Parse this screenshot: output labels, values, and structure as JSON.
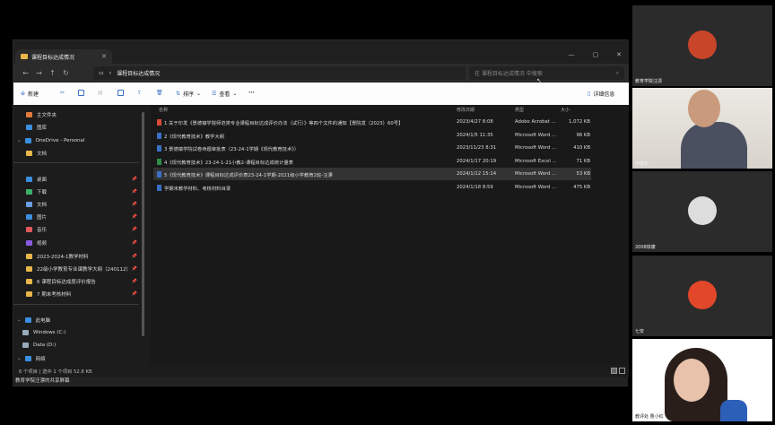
{
  "explorer": {
    "tab_title": "课程目标达成情况",
    "address": "课程目标达成情况",
    "search_placeholder": "在 课程目标达成情况 中搜索",
    "toolbar": {
      "new": "新建",
      "sort": "排序",
      "view": "查看",
      "more": "···",
      "details": "详细信息"
    },
    "sidebar": [
      {
        "label": "主文件夹",
        "icon": "home-icon",
        "color": "#e07a3a",
        "pin": false,
        "expand": false
      },
      {
        "label": "图库",
        "icon": "gallery-icon",
        "color": "#3a8fe0",
        "pin": false,
        "expand": false
      },
      {
        "label": "OneDrive - Personal",
        "icon": "cloud-icon",
        "color": "#3a8fe0",
        "pin": false,
        "expand": true
      },
      {
        "label": "文档",
        "icon": "folder-icon",
        "color": "#e8b64a",
        "pin": false,
        "expand": false
      },
      {
        "label": "桌面",
        "icon": "desktop-icon",
        "color": "#3a8fe0",
        "pin": true,
        "expand": false
      },
      {
        "label": "下载",
        "icon": "download-icon",
        "color": "#3ab06a",
        "pin": true,
        "expand": false
      },
      {
        "label": "文档",
        "icon": "document-icon",
        "color": "#6a9fe0",
        "pin": true,
        "expand": false
      },
      {
        "label": "图片",
        "icon": "picture-icon",
        "color": "#3a8fe0",
        "pin": true,
        "expand": false
      },
      {
        "label": "音乐",
        "icon": "music-icon",
        "color": "#e05a5a",
        "pin": true,
        "expand": false
      },
      {
        "label": "视频",
        "icon": "video-icon",
        "color": "#8a5ae0",
        "pin": true,
        "expand": false
      },
      {
        "label": "2023-2024-1教学材料",
        "icon": "folder-icon",
        "color": "#e8b64a",
        "pin": true,
        "expand": false
      },
      {
        "label": "22级小学教育专业课教学大纲（240112）",
        "icon": "folder-icon",
        "color": "#e8b64a",
        "pin": true,
        "expand": false
      },
      {
        "label": "6 课程目标达成度评价报告",
        "icon": "folder-icon",
        "color": "#e8b64a",
        "pin": true,
        "expand": false
      },
      {
        "label": "7 期末考核材料",
        "icon": "folder-icon",
        "color": "#e8b64a",
        "pin": true,
        "expand": false
      },
      {
        "label": "此电脑",
        "icon": "computer-icon",
        "color": "#3a8fe0",
        "pin": false,
        "expand": true
      },
      {
        "label": "Windows (C:)",
        "icon": "drive-icon",
        "color": "#9ab",
        "pin": false,
        "expand": false
      },
      {
        "label": "Data (D:)",
        "icon": "drive-icon",
        "color": "#9ab",
        "pin": false,
        "expand": false
      },
      {
        "label": "网络",
        "icon": "network-icon",
        "color": "#3a8fe0",
        "pin": false,
        "expand": true
      }
    ],
    "columns": {
      "name": "名称",
      "modified": "修改日期",
      "type": "类型",
      "size": "大小"
    },
    "files": [
      {
        "name": "1 关于印发《景德镇学院师范类专业课程目标达成评价办法（试行）》等四个文件的通知【景院发（2023）60号】",
        "modified": "2023/4/27 8:08",
        "type": "Adobe Acrobat ...",
        "size": "1,072 KB",
        "icon": "pdf-icon",
        "color": "#d94a3a"
      },
      {
        "name": "2《现代教育技术》教学大纲",
        "modified": "2024/1/5 11:35",
        "type": "Microsoft Word ...",
        "size": "96 KB",
        "icon": "word-icon",
        "color": "#3a6fc4"
      },
      {
        "name": "3 景德镇学院试卷命题审批表（23-24-1学期《现代教育技术》）",
        "modified": "2023/11/23 8:31",
        "type": "Microsoft Word ...",
        "size": "410 KB",
        "icon": "word-icon",
        "color": "#3a6fc4"
      },
      {
        "name": "4《现代教育技术》23-24-1-21小教2-课程目标达成统计量表",
        "modified": "2024/1/17 20:19",
        "type": "Microsoft Excel ...",
        "size": "71 KB",
        "icon": "excel-icon",
        "color": "#2e8b4a"
      },
      {
        "name": "5《现代教育技术》课程目标达成评价表23-24-1学期-2021级小学教育2班-汪漂",
        "modified": "2024/1/12 15:14",
        "type": "Microsoft Word ...",
        "size": "53 KB",
        "icon": "word-icon",
        "color": "#3a6fc4"
      },
      {
        "name": "学期末教学材料、考核材料目录",
        "modified": "2024/1/18 8:59",
        "type": "Microsoft Word ...",
        "size": "475 KB",
        "icon": "word-icon",
        "color": "#3a6fc4"
      }
    ],
    "status": "6 个项目  |  选中 1 个项目  52.8 KB",
    "share_label": "教育学院汪漂的共享屏幕"
  },
  "participants": [
    {
      "name": "教育学院汪漂",
      "kind": "avatar",
      "color": "#c8452a"
    },
    {
      "name": "何春松",
      "kind": "video-man",
      "color": "#4a5060"
    },
    {
      "name": "2008徐康",
      "kind": "avatar",
      "color": "#dddddd"
    },
    {
      "name": "七安",
      "kind": "avatar",
      "color": "#e2472a"
    },
    {
      "name": "教评处 曹小红",
      "kind": "video-woman",
      "color": "#ffffff"
    }
  ]
}
